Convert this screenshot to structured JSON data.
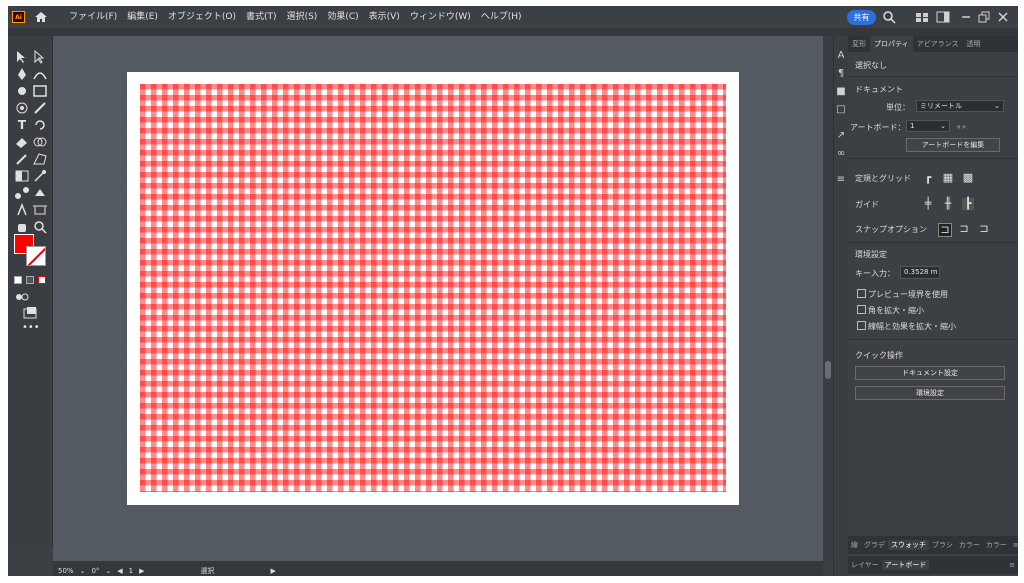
{
  "app": {
    "logo_text": "Ai",
    "menu": [
      "ファイル(F)",
      "編集(E)",
      "オブジェクト(O)",
      "書式(T)",
      "選択(S)",
      "効果(C)",
      "表示(V)",
      "ウィンドウ(W)",
      "ヘルプ(H)"
    ],
    "share_label": "共有"
  },
  "status_bar": {
    "zoom": "50%",
    "rotation": "0°",
    "artboard_num": "1",
    "tool_name": "選択"
  },
  "panel": {
    "tabs": [
      "変形",
      "プロパティ",
      "アピアランス",
      "透明"
    ],
    "active_tab": "プロパティ",
    "selection": "選択なし",
    "document_title": "ドキュメント",
    "unit_label": "単位：",
    "unit_value": "ミリメートル",
    "artboard_label": "アートボード：",
    "artboard_value": "1",
    "edit_artboard_button": "アートボードを編集",
    "ruler_grid_label": "定規とグリッド",
    "guide_label": "ガイド",
    "snap_label": "スナップオプション",
    "prefs_title": "環境設定",
    "key_input_label": "キー入力：",
    "key_input_value": "0.3528 m",
    "check_preview": "プレビュー境界を使用",
    "check_corners": "角を拡大・縮小",
    "check_strokes": "線幅と効果を拡大・縮小",
    "quick_title": "クイック操作",
    "doc_setup_button": "ドキュメント設定",
    "prefs_button": "環境設定",
    "bottom_tabs": [
      "線",
      "グラデ",
      "スウォッチ",
      "ブラシ",
      "カラー",
      "カラー"
    ],
    "bottom_active": "スウォッチ",
    "bottom_tabs2": [
      "レイヤー",
      "アートボード"
    ]
  },
  "colors": {
    "accent": "#2c6fe0",
    "pattern_red": "#ff0000",
    "panel_bg": "#3c3f43",
    "canvas_bg": "#535a62"
  }
}
